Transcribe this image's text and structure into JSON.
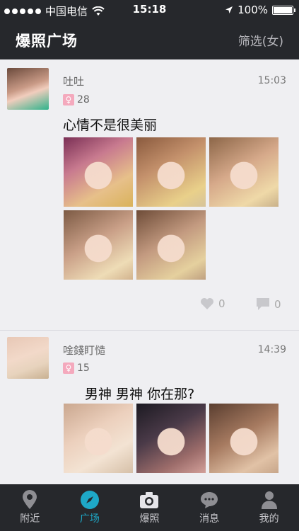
{
  "status_bar": {
    "carrier": "中国电信",
    "time": "15:18",
    "battery": "100%"
  },
  "header": {
    "title": "爆照广场",
    "filter": "筛选(女)"
  },
  "posts": [
    {
      "username": "吐吐",
      "time": "15:03",
      "age": "28",
      "text": "心情不是很美丽",
      "photo_count": 5,
      "likes": "0",
      "comments": "0"
    },
    {
      "username": "唫錢盯慥",
      "time": "14:39",
      "age": "15",
      "text": "男神 男神 你在那?",
      "photo_count": 3
    }
  ],
  "tabs": [
    {
      "label": "附近",
      "icon": "location-pin-icon"
    },
    {
      "label": "广场",
      "icon": "compass-icon",
      "active": true
    },
    {
      "label": "爆照",
      "icon": "camera-icon"
    },
    {
      "label": "消息",
      "icon": "chat-bubble-icon"
    },
    {
      "label": "我的",
      "icon": "person-icon"
    }
  ],
  "colors": {
    "bar_bg": "#26282c",
    "accent": "#1ea8c7",
    "gender_badge": "#f4a9bd",
    "feed_bg": "#efeff2"
  }
}
